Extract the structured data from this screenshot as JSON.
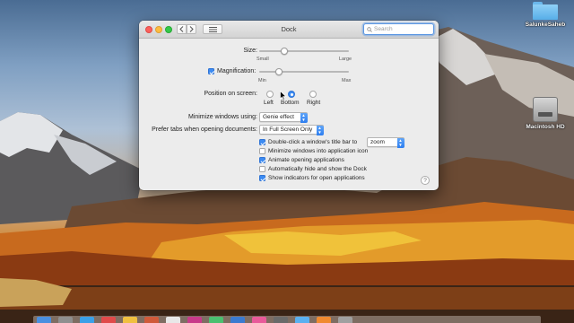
{
  "window": {
    "title": "Dock",
    "search_placeholder": "Search"
  },
  "size": {
    "label": "Size:",
    "min_label": "Small",
    "max_label": "Large",
    "value_fraction": 0.28
  },
  "magnification": {
    "label": "Magnification:",
    "checked": true,
    "min_label": "Min",
    "max_label": "Max",
    "value_fraction": 0.22
  },
  "position": {
    "label": "Position on screen:",
    "options": [
      "Left",
      "Bottom",
      "Right"
    ],
    "selected": "Bottom"
  },
  "minimize": {
    "label": "Minimize windows using:",
    "value": "Genie effect"
  },
  "prefer_tabs": {
    "label": "Prefer tabs when opening documents:",
    "value": "In Full Screen Only"
  },
  "checkboxes": [
    {
      "label": "Double-click a window's title bar to",
      "checked": true
    },
    {
      "label": "Minimize windows into application icon",
      "checked": false
    },
    {
      "label": "Animate opening applications",
      "checked": true
    },
    {
      "label": "Automatically hide and show the Dock",
      "checked": false
    },
    {
      "label": "Show indicators for open applications",
      "checked": true
    }
  ],
  "double_click_action": "zoom",
  "help_label": "?",
  "desktop": {
    "folder_label": "SalunkeSaheb",
    "drive_label": "Macintosh HD"
  },
  "colors": {
    "accent": "#3c8bf2",
    "close": "#fc605c",
    "minimize": "#fdbc40",
    "maximize": "#34c84a"
  },
  "icons": [
    "back-chevron-icon",
    "forward-chevron-icon",
    "grid-icon",
    "search-icon",
    "folder-icon",
    "hard-drive-icon",
    "pointer-cursor-icon"
  ]
}
